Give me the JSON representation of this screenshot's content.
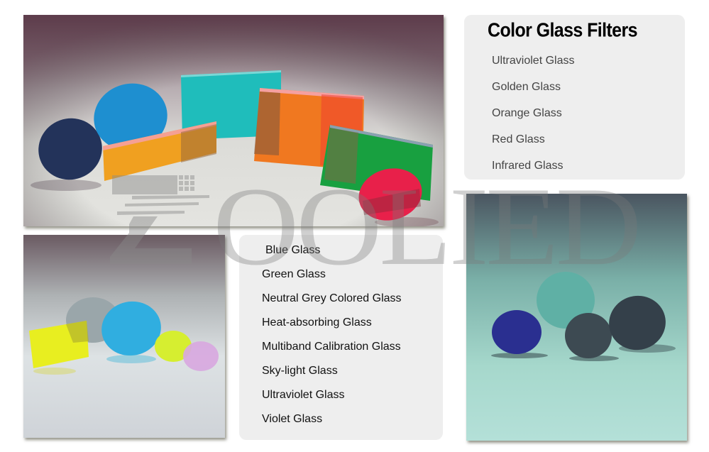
{
  "header": {
    "title": "Color Glass Filters"
  },
  "top_list": {
    "items": [
      {
        "label": "Ultraviolet Glass"
      },
      {
        "label": "Golden Glass"
      },
      {
        "label": "Orange Glass"
      },
      {
        "label": "Red Glass"
      },
      {
        "label": "Infrared Glass"
      }
    ]
  },
  "bottom_list": {
    "items": [
      {
        "label": "Blue Glass"
      },
      {
        "label": "Green Glass"
      },
      {
        "label": "Neutral Grey Colored Glass"
      },
      {
        "label": "Heat-absorbing Glass"
      },
      {
        "label": "Multiband Calibration Glass"
      },
      {
        "label": "Sky-light Glass"
      },
      {
        "label": "Ultraviolet Glass"
      },
      {
        "label": "Violet Glass"
      }
    ]
  },
  "watermark": {
    "text": "ZOOLIED"
  },
  "photos": {
    "top": {
      "subject": "assorted color glass filters: navy disc, blue disc, orange plate, cyan plate, orange-red plate, green plate, red disc"
    },
    "bottom_left": {
      "subject": "yellow plate, grey disc, sky-blue disc, yellow-green disc, violet disc"
    },
    "right": {
      "subject": "blue disc, teal disc, grey disc, dark grey disc"
    }
  },
  "colors": {
    "panel_bg": "#eeeeee",
    "title_text": "#000000",
    "list_text_top": "#444444",
    "list_text_bottom": "#111111",
    "watermark": "#9a9a9a"
  }
}
